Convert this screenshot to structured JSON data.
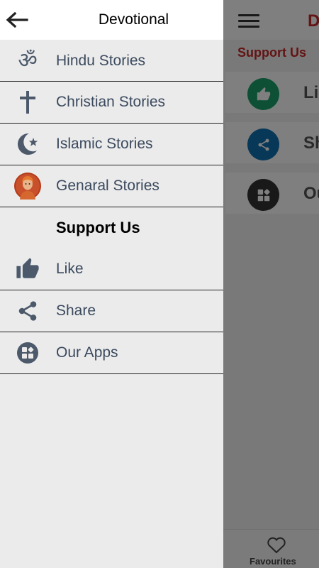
{
  "drawer": {
    "title": "Devotional",
    "stories": [
      {
        "label": "Hindu Stories",
        "icon": "om-icon"
      },
      {
        "label": "Christian Stories",
        "icon": "cross-icon"
      },
      {
        "label": "Islamic Stories",
        "icon": "crescent-star-icon"
      },
      {
        "label": "Genaral Stories",
        "icon": "portrait-avatar"
      }
    ],
    "support_title": "Support Us",
    "support": [
      {
        "label": "Like",
        "icon": "thumbs-up-icon"
      },
      {
        "label": "Share",
        "icon": "share-icon"
      },
      {
        "label": "Our Apps",
        "icon": "apps-grid-icon"
      }
    ]
  },
  "background": {
    "title_initial": "D",
    "support_heading": "Support Us",
    "rows": [
      {
        "text": "Li",
        "icon": "thumbs-up-icon",
        "color": "#1aa06a"
      },
      {
        "text": "Sh",
        "icon": "share-icon",
        "color": "#1170b0"
      },
      {
        "text": "Ou",
        "icon": "apps-grid-icon",
        "color": "#333333"
      }
    ],
    "tab_label": "Favourites"
  },
  "colors": {
    "accent_red": "#c62828",
    "label_slate": "#3b4a5e",
    "icon_slate": "#4b596b"
  }
}
